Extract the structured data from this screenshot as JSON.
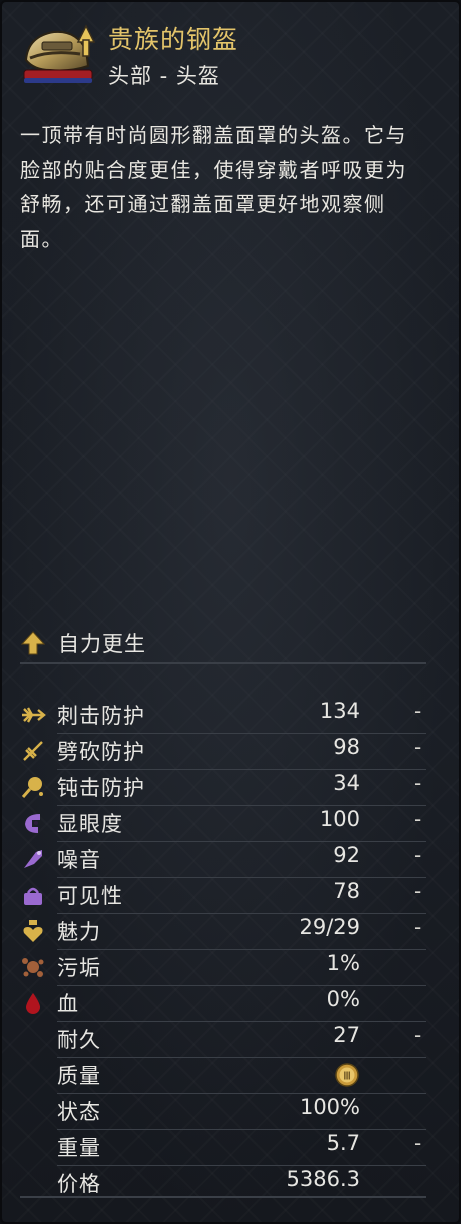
{
  "item": {
    "name": "贵族的钢盔",
    "category": "头部 - 头盔",
    "description": "一顶带有时尚圆形翻盖面罩的头盔。它与脸部的贴合度更佳，使得穿戴者呼吸更为舒畅，还可通过翻盖面罩更好地观察侧面。",
    "icon": "noble-steel-helmet-icon"
  },
  "effect": {
    "icon": "upgrade-arrow-icon",
    "label": "自力更生"
  },
  "stats": [
    {
      "icon": "stab-icon",
      "name": "刺击防护",
      "value": "134",
      "cmp": "-"
    },
    {
      "icon": "slash-icon",
      "name": "劈砍防护",
      "value": "98",
      "cmp": "-"
    },
    {
      "icon": "blunt-icon",
      "name": "钝击防护",
      "value": "34",
      "cmp": "-"
    },
    {
      "icon": "conspicuous-icon",
      "name": "显眼度",
      "value": "100",
      "cmp": "-"
    },
    {
      "icon": "noise-icon",
      "name": "噪音",
      "value": "92",
      "cmp": "-"
    },
    {
      "icon": "visibility-icon",
      "name": "可见性",
      "value": "78",
      "cmp": "-"
    },
    {
      "icon": "charisma-icon",
      "name": "魅力",
      "value": "29/29",
      "cmp": "-"
    },
    {
      "icon": "dirt-icon",
      "name": "污垢",
      "value": "1%",
      "cmp": ""
    },
    {
      "icon": "blood-icon",
      "name": "血",
      "value": "0%",
      "cmp": ""
    },
    {
      "icon": "",
      "name": "耐久",
      "value": "27",
      "cmp": "-"
    },
    {
      "icon": "",
      "name": "质量",
      "value": "Ⅲ",
      "cmp": ""
    },
    {
      "icon": "",
      "name": "状态",
      "value": "100%",
      "cmp": ""
    },
    {
      "icon": "",
      "name": "重量",
      "value": "5.7",
      "cmp": "-"
    },
    {
      "icon": "",
      "name": "价格",
      "value": "5386.3",
      "cmp": ""
    }
  ],
  "colors": {
    "title": "#e3c46a",
    "accent_gold": "#d8b24a",
    "purple": "#9a6ad0",
    "blood": "#b0141e",
    "dirt": "#a3603a"
  }
}
